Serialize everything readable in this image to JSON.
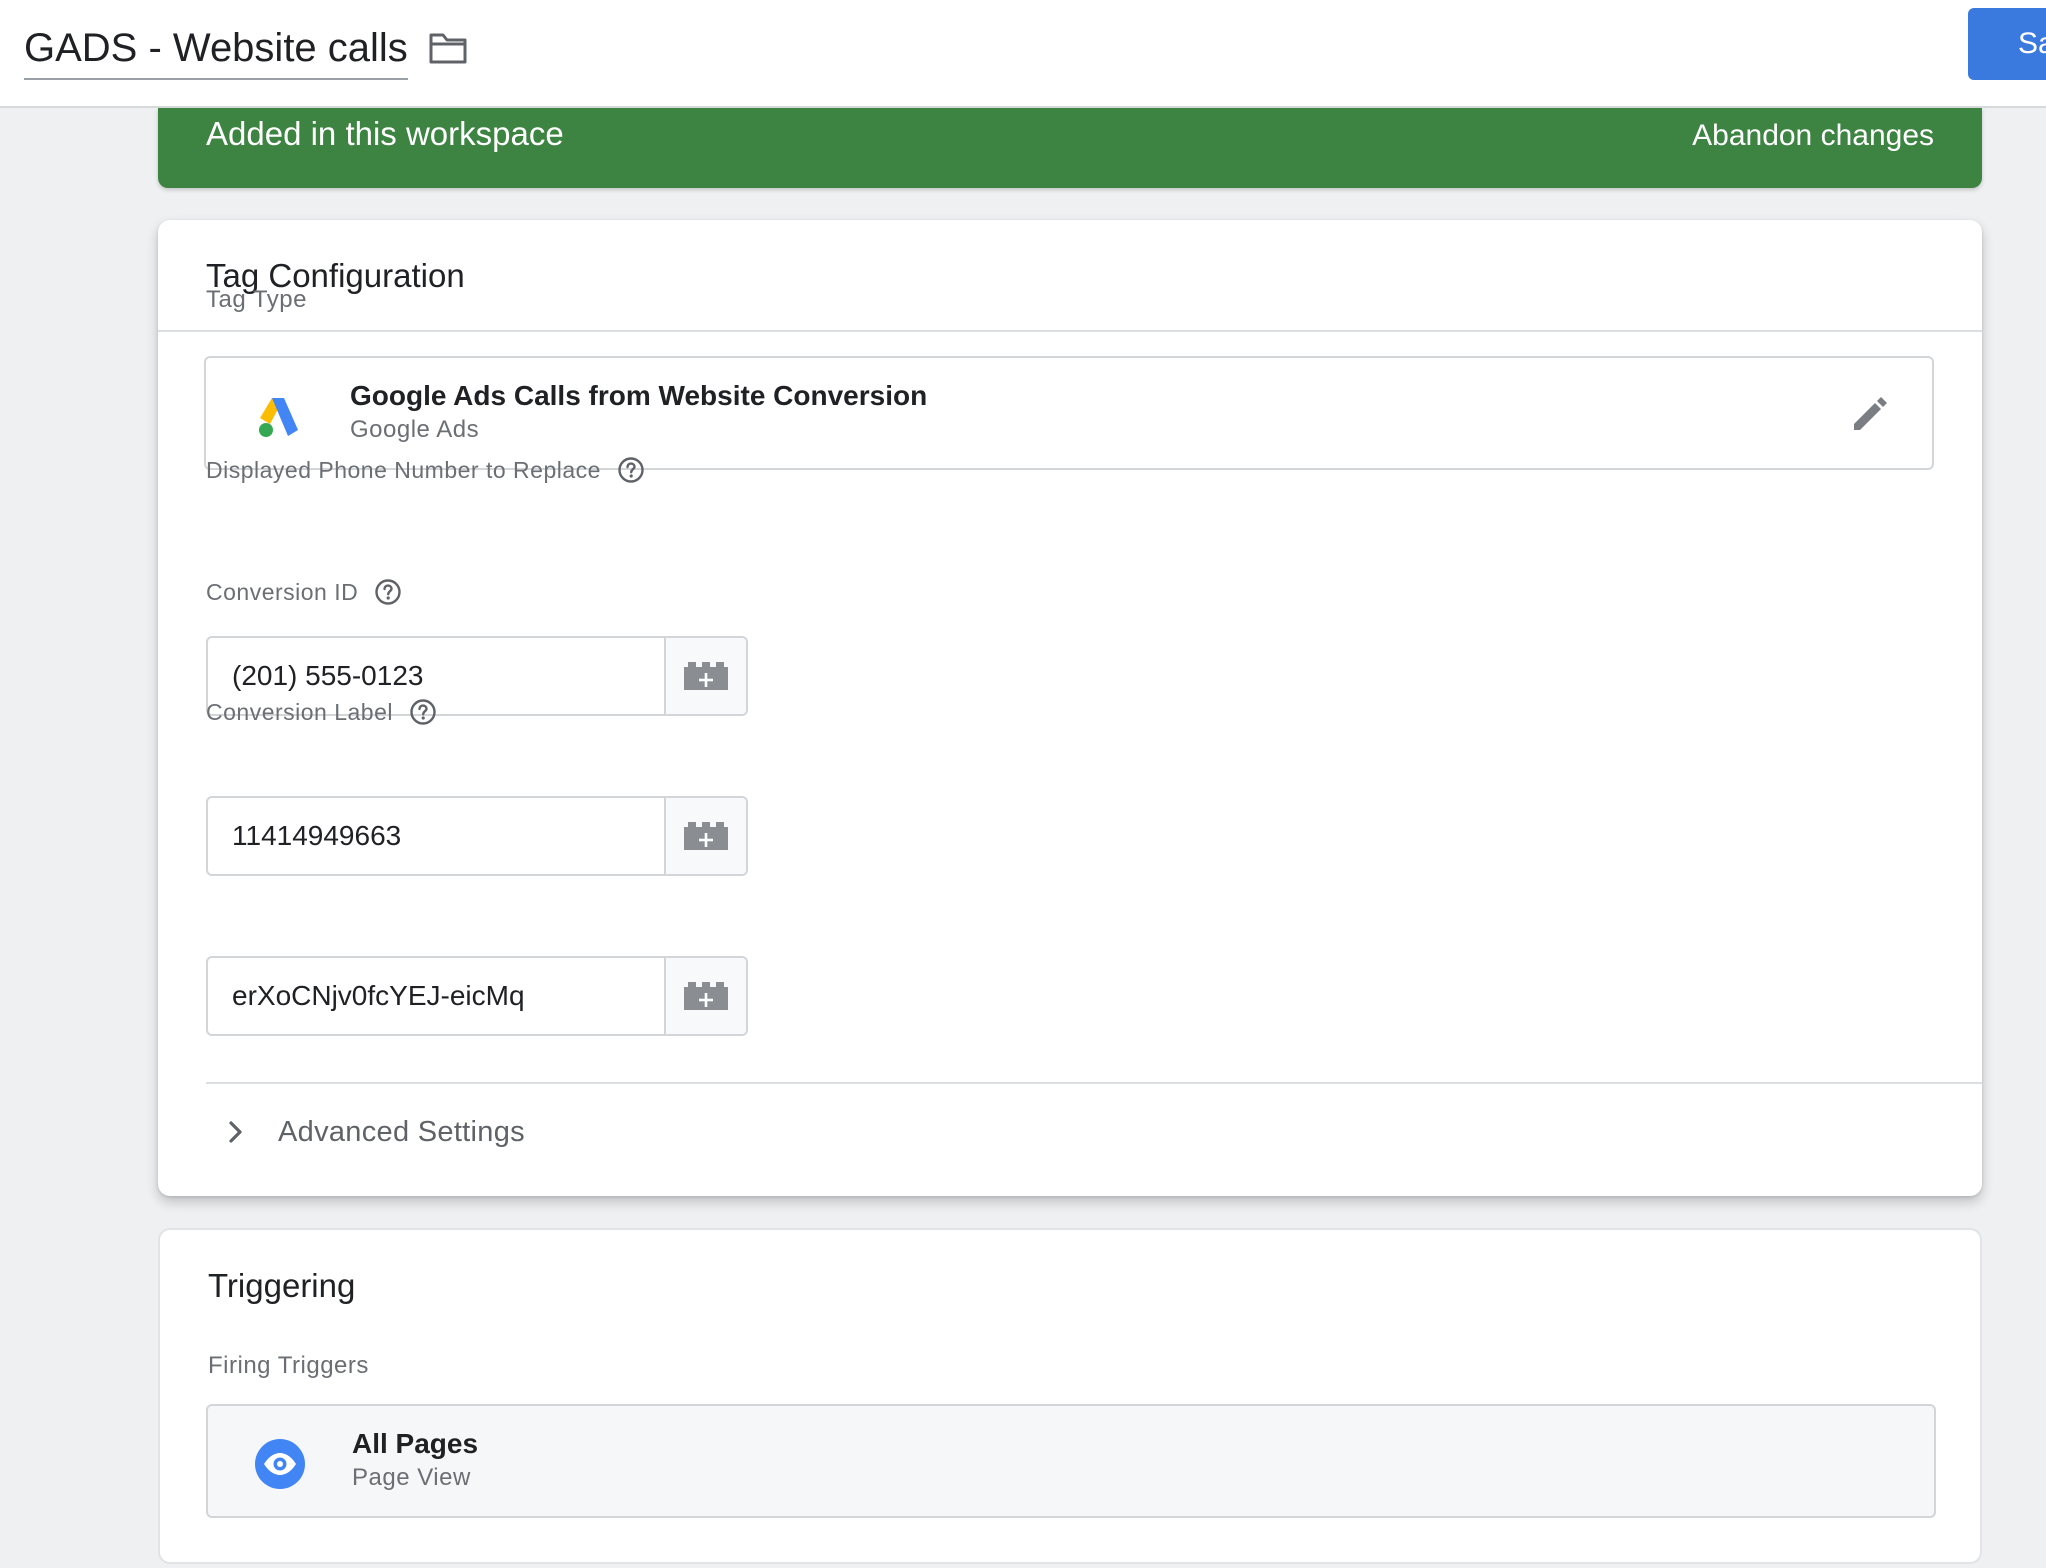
{
  "header": {
    "tag_name": "GADS - Website calls",
    "save_label": "Save",
    "folder_icon": "folder-icon"
  },
  "banner": {
    "status_text": "Added in this workspace",
    "abandon_label": "Abandon changes",
    "color": "#3d8442"
  },
  "tag_configuration": {
    "title": "Tag Configuration",
    "tag_type_label": "Tag Type",
    "tag_type": {
      "name": "Google Ads Calls from Website Conversion",
      "provider": "Google Ads",
      "icon": "google-ads-logo-icon",
      "edit_icon": "pencil-icon"
    },
    "fields": [
      {
        "label": "Displayed Phone Number to Replace",
        "value": "(201) 555-0123",
        "help_icon": "help-circle-icon",
        "variable_icon": "variable-picker-icon"
      },
      {
        "label": "Conversion ID",
        "value": "11414949663",
        "help_icon": "help-circle-icon",
        "variable_icon": "variable-picker-icon"
      },
      {
        "label": "Conversion Label",
        "value": "erXoCNjv0fcYEJ-eicMq",
        "help_icon": "help-circle-icon",
        "variable_icon": "variable-picker-icon"
      }
    ],
    "advanced_settings_label": "Advanced Settings",
    "advanced_icon": "chevron-right-icon"
  },
  "triggering": {
    "title": "Triggering",
    "firing_triggers_label": "Firing Triggers",
    "trigger": {
      "name": "All Pages",
      "type": "Page View",
      "icon": "eye-icon",
      "icon_color": "#4285f4"
    }
  },
  "colors": {
    "accent_blue": "#3a79dd",
    "banner_green": "#3d8442",
    "google_blue": "#4285f4",
    "google_yellow": "#fbbc04",
    "google_green": "#34a853"
  }
}
